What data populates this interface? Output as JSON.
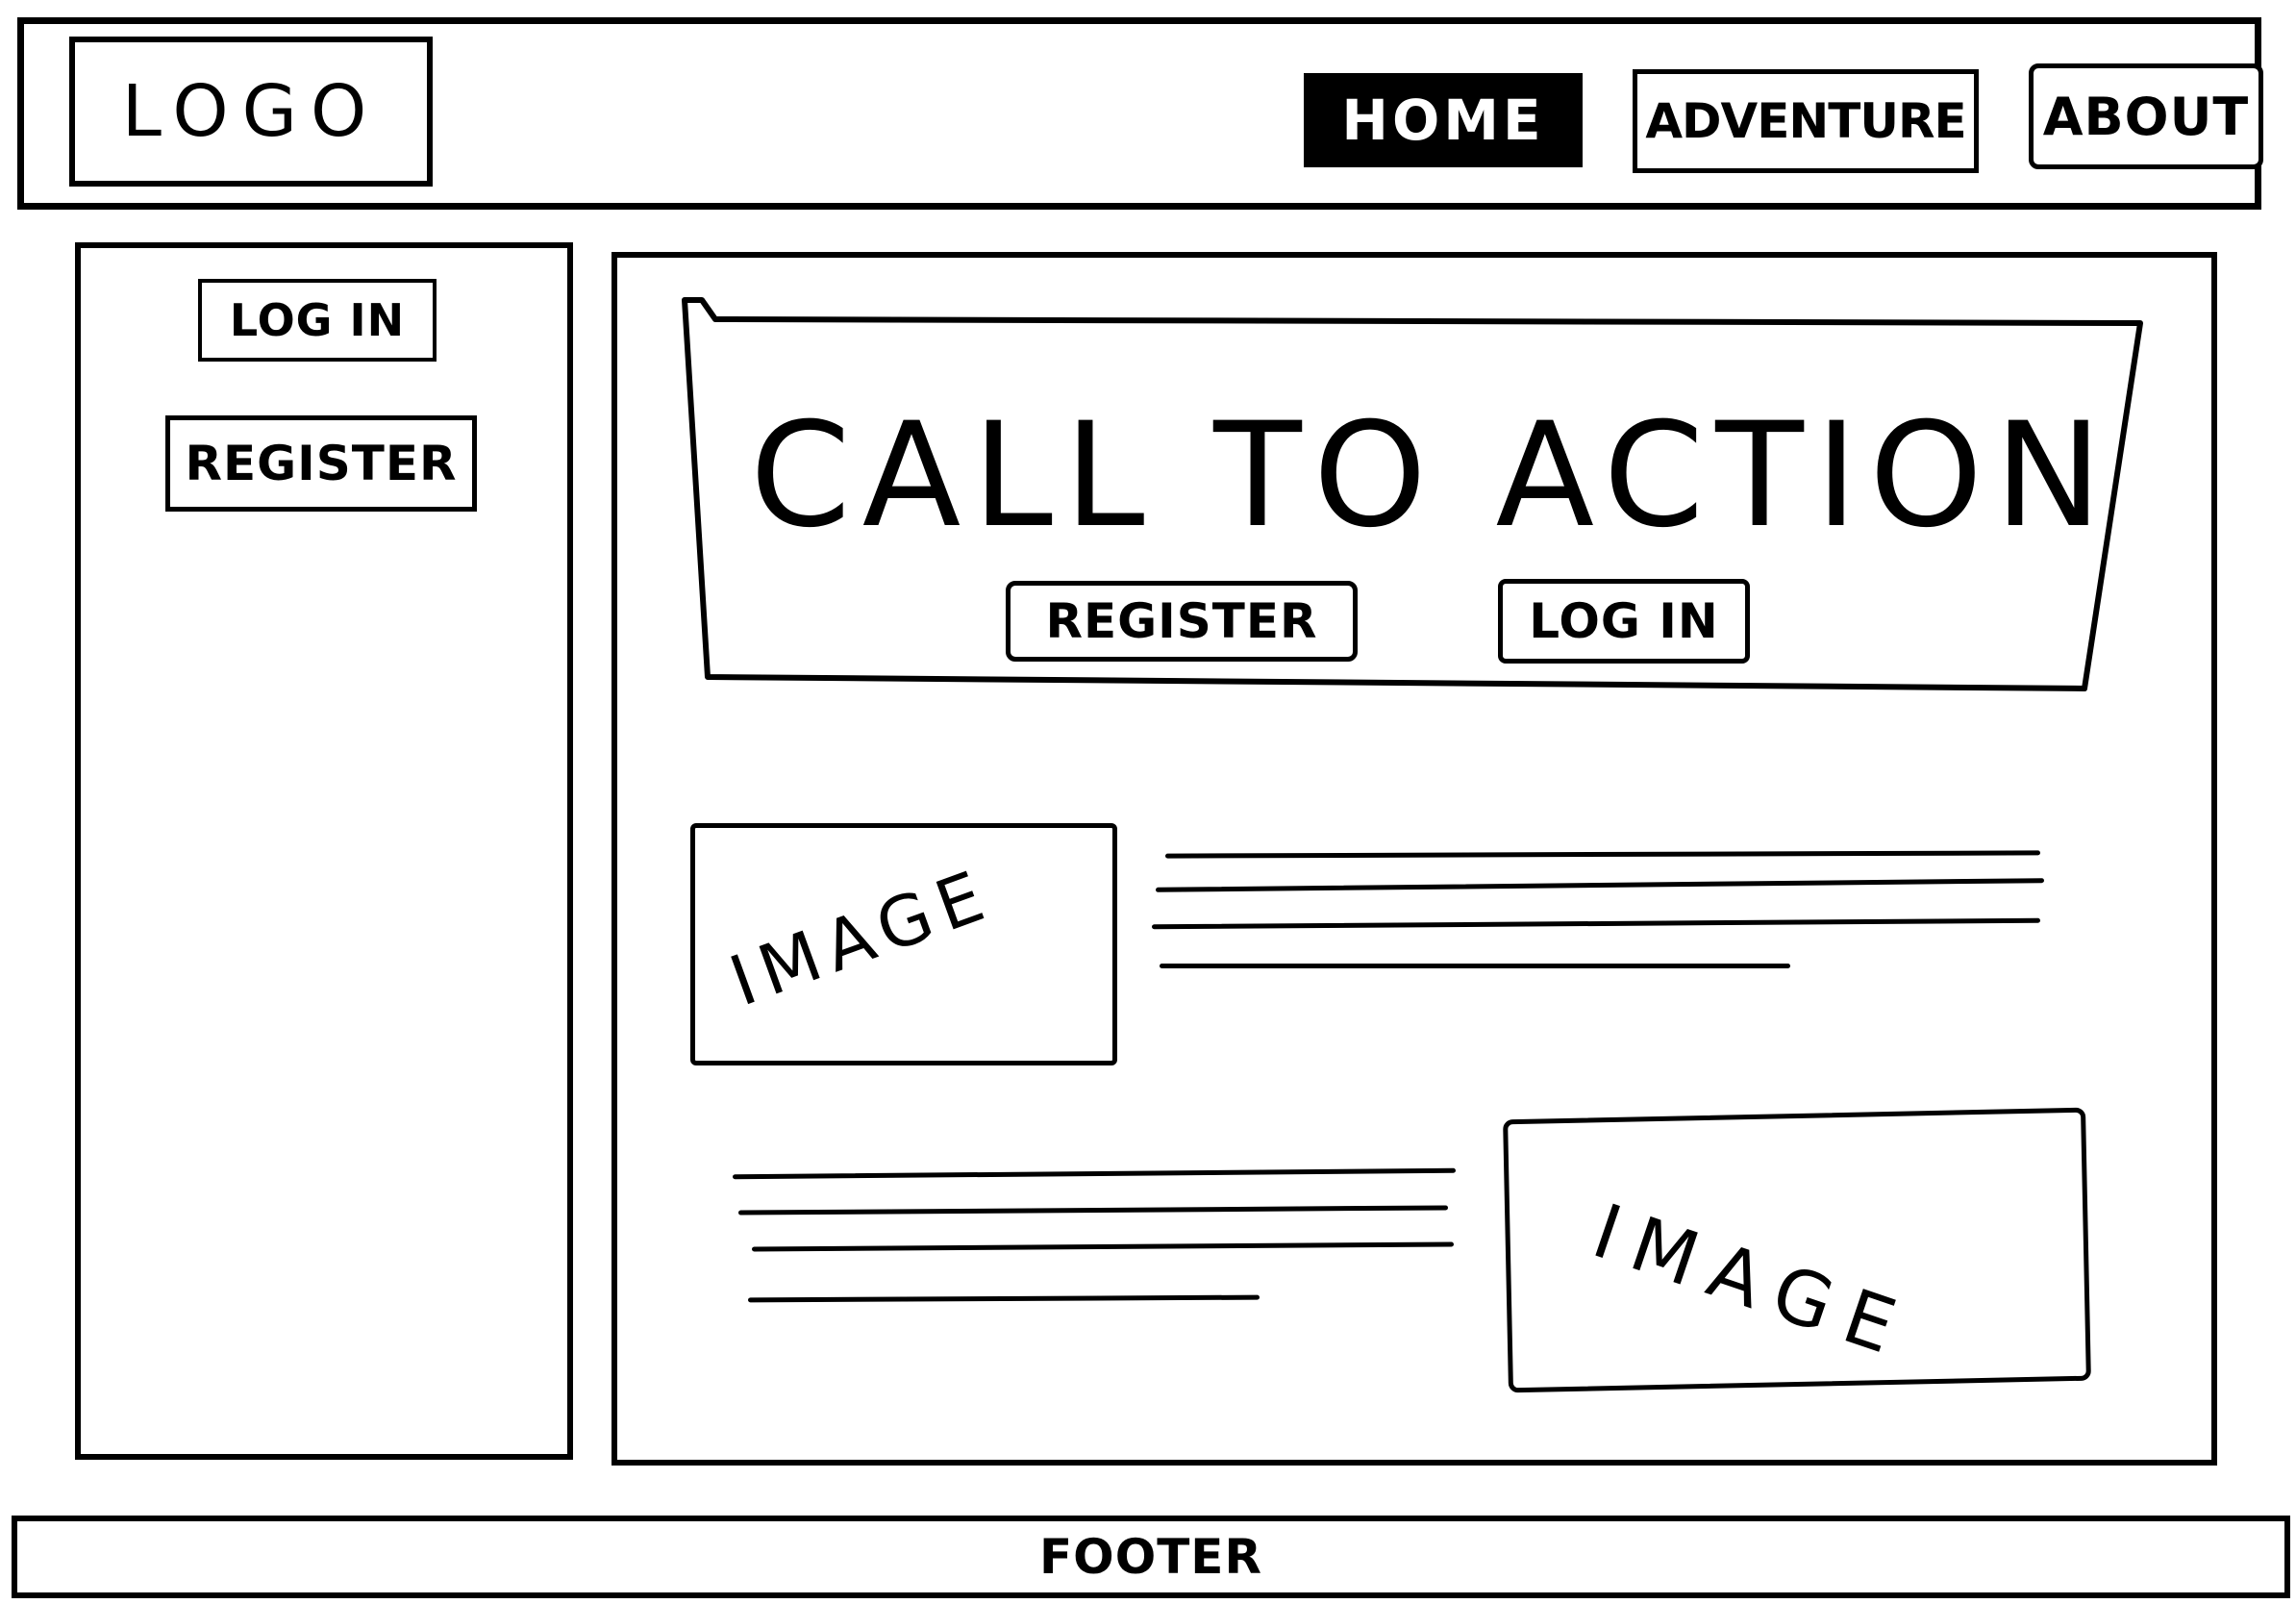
{
  "header": {
    "logo": "LOGO",
    "nav": {
      "home": "HOME",
      "adventure": "ADVENTURE",
      "about": "ABOUT"
    },
    "active_item": "HOME"
  },
  "sidebar": {
    "login_label": "LOG IN",
    "register_label": "REGISTER"
  },
  "main": {
    "cta": {
      "title": "CALL TO ACTION",
      "register_label": "REGISTER",
      "login_label": "LOG IN"
    },
    "content_rows": [
      {
        "image_label": "IMAGE",
        "text_lines": 4
      },
      {
        "image_label": "IMAGE",
        "text_lines": 4
      }
    ]
  },
  "footer": {
    "label": "FOOTER"
  },
  "colors": {
    "ink": "#000000",
    "paper": "#ffffff"
  }
}
